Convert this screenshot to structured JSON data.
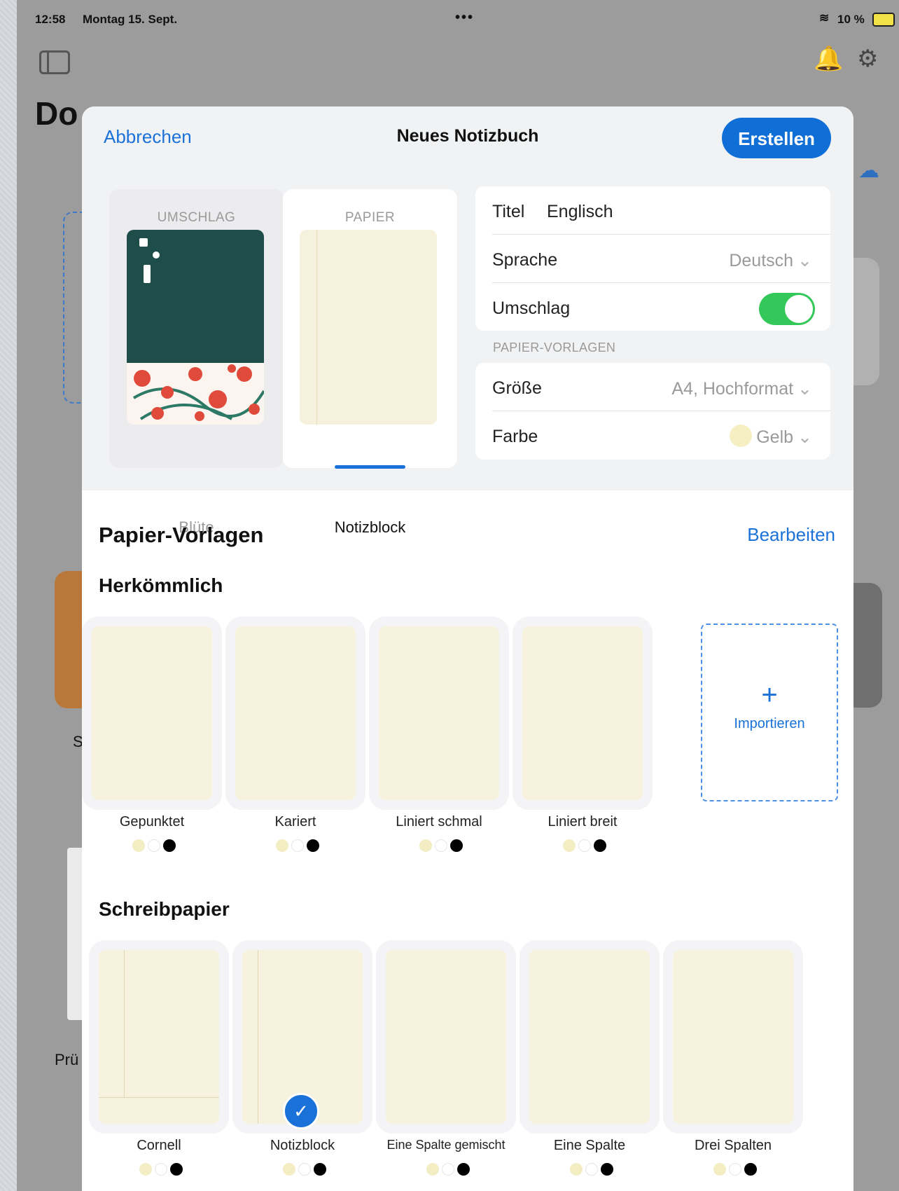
{
  "status_bar": {
    "time": "12:58",
    "date": "Montag 15. Sept.",
    "dots": "•••",
    "battery": "10 %"
  },
  "background": {
    "title_partial": "Do",
    "label_s": "S",
    "label_pru": "Prü"
  },
  "header": {
    "cancel": "Abbrechen",
    "title": "Neues Notizbuch",
    "create": "Erstellen"
  },
  "cover_picker": {
    "label": "UMSCHLAG",
    "name": "Blüte"
  },
  "paper_picker": {
    "label": "PAPIER",
    "name": "Notizblock"
  },
  "form": {
    "title_key": "Titel",
    "title_value": "Englisch",
    "language_key": "Sprache",
    "language_value": "Deutsch",
    "cover_key": "Umschlag",
    "cover_enabled": true,
    "section_caption": "PAPIER-VORLAGEN",
    "size_key": "Größe",
    "size_value": "A4, Hochformat",
    "color_key": "Farbe",
    "color_value": "Gelb"
  },
  "templates_section": {
    "title": "Papier-Vorlagen",
    "edit": "Bearbeiten"
  },
  "conventional": {
    "title": "Herkömmlich",
    "items": [
      {
        "name": "Gepunktet"
      },
      {
        "name": "Kariert"
      },
      {
        "name": "Liniert schmal"
      },
      {
        "name": "Liniert breit"
      }
    ],
    "import": {
      "plus": "+",
      "label": "Importieren"
    }
  },
  "writing": {
    "title": "Schreibpapier",
    "items": [
      {
        "name": "Cornell"
      },
      {
        "name": "Notizblock",
        "selected": true
      },
      {
        "name": "Eine Spalte gemischt"
      },
      {
        "name": "Eine Spalte"
      },
      {
        "name": "Drei Spalten"
      }
    ]
  },
  "colors": {
    "accent": "#1a72d9",
    "toggle_on": "#34c759",
    "paper_yellow": "#f6f2dd",
    "cover_green": "#1f4e4a"
  },
  "color_dots": [
    "#f3edc4",
    "#ffffff",
    "#000000"
  ]
}
